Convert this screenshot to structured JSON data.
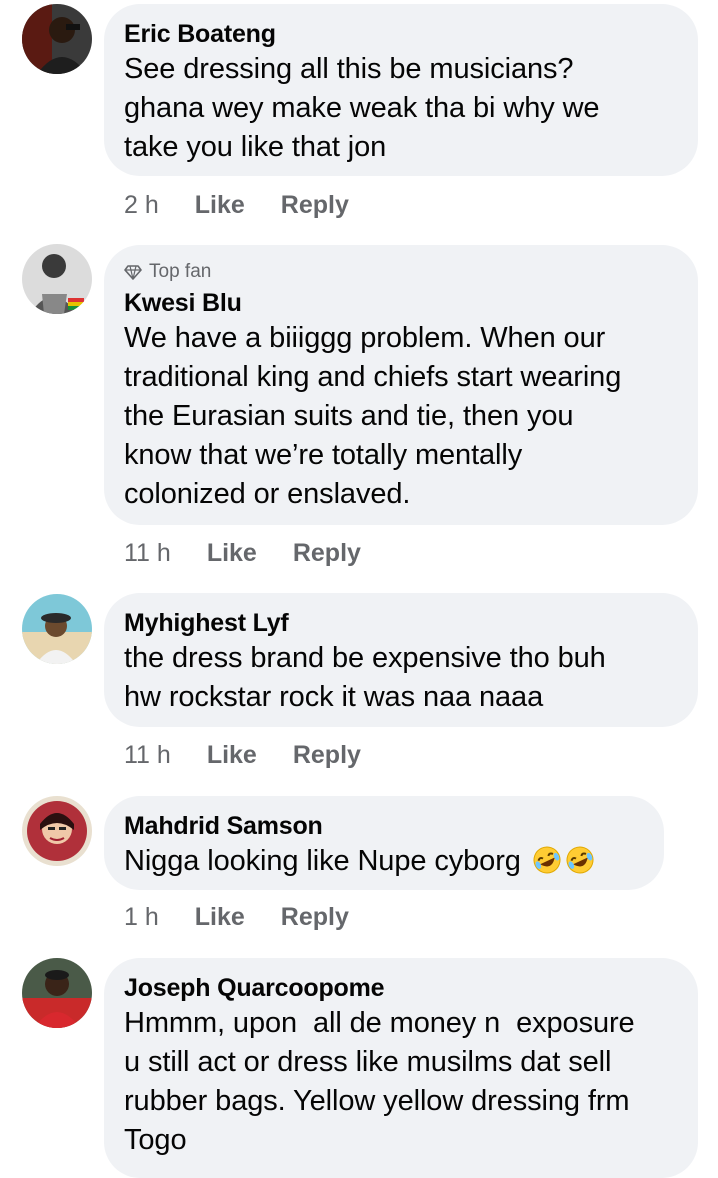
{
  "comments": [
    {
      "author": "Eric Boateng",
      "text": "See dressing all this be musicians? ghana wey make weak tha bi why we take you like that jon",
      "lines": [
        "See dressing all this be musicians?",
        "ghana wey make weak tha bi why we",
        "take you like that jon"
      ],
      "time": "2 h",
      "like": "Like",
      "reply": "Reply"
    },
    {
      "badge": "Top fan",
      "author": "Kwesi Blu",
      "text": "We have a biiiggg problem. When our traditional king and chiefs start wearing the Eurasian suits and tie, then you know that we’re totally mentally colonized or enslaved.",
      "lines": [
        "We have a biiiggg problem. When our",
        "traditional king and chiefs start wearing",
        "the Eurasian suits and tie, then you",
        "know that we’re totally mentally",
        "colonized or enslaved."
      ],
      "time": "11 h",
      "like": "Like",
      "reply": "Reply"
    },
    {
      "author": "Myhighest Lyf",
      "text": "the dress brand be expensive tho buh hw rockstar rock it was naa naaa",
      "lines": [
        "the dress brand be expensive tho buh",
        "hw rockstar rock it was naa naaa"
      ],
      "time": "11 h",
      "like": "Like",
      "reply": "Reply"
    },
    {
      "author": "Mahdrid Samson",
      "text": "Nigga looking like Nupe cyborg",
      "emojis": [
        "rolling-on-floor-laughing",
        "rolling-on-floor-laughing"
      ],
      "time": "1 h",
      "like": "Like",
      "reply": "Reply"
    },
    {
      "author": "Joseph Quarcoopome",
      "text": "Hmmm, upon  all de money n  exposure u still act or dress like musilms dat sell rubber bags. Yellow yellow dressing frm Togo",
      "lines": [
        "Hmmm, upon  all de money n  exposure",
        "u still act or dress like musilms dat sell",
        "rubber bags. Yellow yellow dressing frm",
        "Togo"
      ]
    }
  ],
  "colors": {
    "bubble": "#f0f2f5",
    "meta": "#65676b",
    "text": "#050505"
  }
}
